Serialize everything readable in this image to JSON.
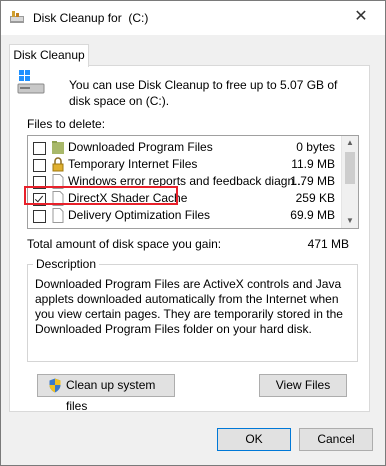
{
  "window": {
    "title": "Disk Cleanup for  (C:)"
  },
  "tab": {
    "label": "Disk Cleanup"
  },
  "intro": {
    "text": "You can use Disk Cleanup to free up to 5.07 GB of disk space on  (C:)."
  },
  "files": {
    "label": "Files to delete:",
    "items": [
      {
        "name": "Downloaded Program Files",
        "size": "0 bytes",
        "checked": false,
        "icon": "folder-icon"
      },
      {
        "name": "Temporary Internet Files",
        "size": "11.9 MB",
        "checked": false,
        "icon": "lock-icon"
      },
      {
        "name": "Windows error reports and feedback diagn...",
        "size": "1.79 MB",
        "checked": false,
        "icon": "document-icon"
      },
      {
        "name": "DirectX Shader Cache",
        "size": "259 KB",
        "checked": true,
        "icon": "document-icon"
      },
      {
        "name": "Delivery Optimization Files",
        "size": "69.9 MB",
        "checked": false,
        "icon": "document-icon"
      }
    ]
  },
  "total": {
    "label": "Total amount of disk space you gain:",
    "value": "471 MB"
  },
  "description": {
    "title": "Description",
    "text": "Downloaded Program Files are ActiveX controls and Java applets downloaded automatically from the Internet when you view certain pages. They are temporarily stored in the Downloaded Program Files folder on your hard disk."
  },
  "buttons": {
    "cleanup_system": "Clean up system files",
    "view_files": "View Files",
    "ok": "OK",
    "cancel": "Cancel"
  },
  "colors": {
    "highlight": "#e8202a",
    "accent": "#0078d7"
  }
}
